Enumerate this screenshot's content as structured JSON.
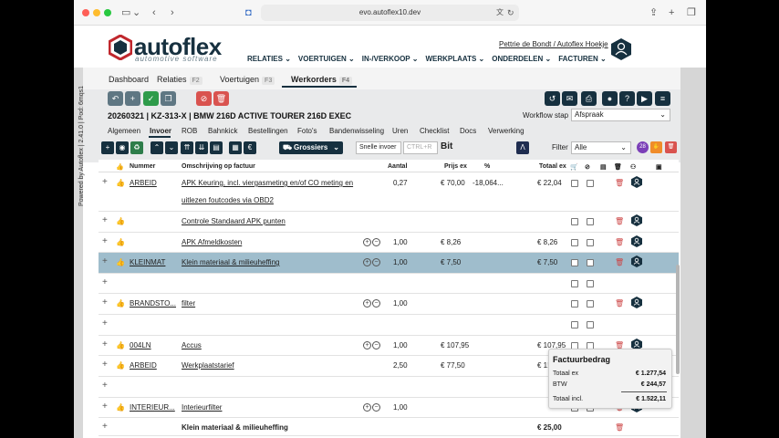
{
  "browser": {
    "url": "evo.autoflex10.dev"
  },
  "side": {
    "text": "Powered by Autoflex | 2.41.0 | Pod: 6mqs1"
  },
  "header": {
    "brand": "autoflex",
    "brand_sub": "automotive software",
    "user": "Pettrie de Bondt / Autoflex Hoekje",
    "nav": [
      "RELATIES",
      "VOERTUIGEN",
      "IN-/VERKOOP",
      "WERKPLAATS",
      "ONDERDELEN",
      "FACTUREN"
    ]
  },
  "tabs": [
    {
      "label": "Dashboard",
      "key": ""
    },
    {
      "label": "Relaties",
      "key": "F2"
    },
    {
      "label": "Voertuigen",
      "key": "F3"
    },
    {
      "label": "Werkorders",
      "key": "F4"
    }
  ],
  "order": {
    "title": "20260321 | KZ-313-X | BMW 216D ACTIVE TOURER 216D EXEC",
    "workflow_label": "Workflow stap",
    "workflow_value": "Afspraak"
  },
  "subtabs": [
    "Algemeen",
    "Invoer",
    "ROB",
    "Bahnkick",
    "Bestellingen",
    "Foto's",
    "Bandenwisseling",
    "Uren",
    "Checklist",
    "Docs",
    "Verwerking"
  ],
  "toolbar": {
    "grossiers": "Grossiers",
    "snel_label": "Snelle invoer",
    "snel_placeholder": "CTRL+R",
    "bit": "Bit",
    "filter_label": "Filter",
    "filter_value": "Alle",
    "badge": "28"
  },
  "table": {
    "headers": {
      "nummer": "Nummer",
      "omschrijving": "Omschrijving op factuur",
      "aantal": "Aantal",
      "prijs": "Prijs ex",
      "pct": "%",
      "totaal": "Totaal ex"
    },
    "rows": [
      {
        "nummer": "ARBEID",
        "omschrijving": "APK Keuring, incl. viergasmeting en/of CO meting en",
        "omschrijving2": "uitlezen foutcodes via OBD2",
        "aantal": "0,27",
        "prijs": "€ 70,00",
        "pct": "-18,064...",
        "totaal": "€ 22,04"
      },
      {
        "nummer": "",
        "omschrijving": "Controle Standaard APK punten",
        "aantal": "",
        "prijs": "",
        "pct": "",
        "totaal": ""
      },
      {
        "nummer": "",
        "omschrijving": "APK Afmeldkosten",
        "aantal": "1,00",
        "prijs": "€ 8,26",
        "pct": "",
        "totaal": "€ 8,26"
      },
      {
        "nummer": "KLEINMAT",
        "omschrijving": "Klein materiaal & milieuheffing",
        "aantal": "1,00",
        "prijs": "€ 7,50",
        "pct": "",
        "totaal": "€ 7,50"
      },
      {
        "nummer": "",
        "omschrijving": "",
        "aantal": "",
        "prijs": "",
        "pct": "",
        "totaal": ""
      },
      {
        "nummer": "BRANDSTO...",
        "omschrijving": "filter",
        "aantal": "1,00",
        "prijs": "",
        "pct": "",
        "totaal": ""
      },
      {
        "nummer": "",
        "omschrijving": "",
        "aantal": "",
        "prijs": "",
        "pct": "",
        "totaal": ""
      },
      {
        "nummer": "004LN",
        "omschrijving": "Accus",
        "aantal": "1,00",
        "prijs": "€ 107,95",
        "pct": "",
        "totaal": "€ 107,95"
      },
      {
        "nummer": "ARBEID",
        "omschrijving": "Werkplaatstarief",
        "aantal": "2,50",
        "prijs": "€ 77,50",
        "pct": "",
        "totaal": "€ 1!"
      },
      {
        "nummer": "",
        "omschrijving": "",
        "aantal": "",
        "prijs": "",
        "pct": "",
        "totaal": ""
      },
      {
        "nummer": "INTERIEUR...",
        "omschrijving": "Interieurfilter",
        "aantal": "1,00",
        "prijs": "",
        "pct": "",
        "totaal": ""
      },
      {
        "nummer": "",
        "omschrijving": "Klein materiaal & milieuheffing",
        "aantal": "",
        "prijs": "",
        "pct": "",
        "totaal": "€ 25,00"
      }
    ]
  },
  "invoice": {
    "title": "Factuurbedrag",
    "totaal_ex_label": "Totaal ex",
    "totaal_ex": "€ 1.277,54",
    "btw_label": "BTW",
    "btw": "€ 244,57",
    "totaal_incl_label": "Totaal incl.",
    "totaal_incl": "€ 1.522,11"
  }
}
